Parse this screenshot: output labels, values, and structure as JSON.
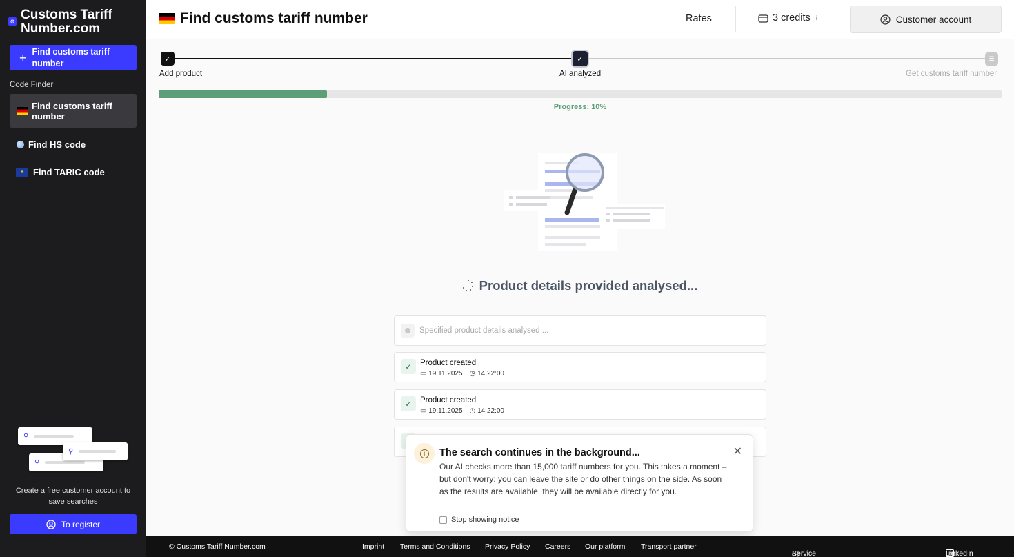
{
  "brand": {
    "name": "Customs Tariff Number.com"
  },
  "sidebar": {
    "new_button": "Find customs tariff number",
    "section_label": "Code Finder",
    "items": [
      {
        "label": "Find customs tariff number",
        "icon": "flag-de-icon",
        "active": true
      },
      {
        "label": "Find HS code",
        "icon": "globe-icon",
        "active": false
      },
      {
        "label": "Find TARIC code",
        "icon": "flag-eu-icon",
        "active": false
      }
    ],
    "register_text": "Create a free customer account to save searches",
    "register_button": "To register"
  },
  "header": {
    "title": "Find customs tariff number",
    "rates": "Rates",
    "credits": "3 credits",
    "credits_info": "i",
    "account": "Customer account"
  },
  "stepper": {
    "steps": [
      {
        "label": "Add product",
        "state": "done"
      },
      {
        "label": "AI analyzed",
        "state": "current"
      },
      {
        "label": "Get customs tariff number",
        "state": "pending"
      }
    ]
  },
  "progress": {
    "value": 0.2,
    "label": "Progress: 10%"
  },
  "analysis": {
    "title": "Product details provided analysed..."
  },
  "log": {
    "pending": "Specified product details analysed ...",
    "items": [
      {
        "title": "Product created",
        "date": "19.11.2025",
        "time": "14:22:00"
      },
      {
        "title": "Product created",
        "date": "19.11.2025",
        "time": "14:22:00"
      }
    ]
  },
  "toast": {
    "title": "The search continues in the background...",
    "body": "Our AI checks more than 15,000 tariff numbers for you. This takes a moment – but don't worry: you can leave the site or do other things on the side. As soon as the results are available, they will be available directly for you.",
    "checkbox": "Stop showing notice"
  },
  "footer": {
    "copyright": "© Customs Tariff Number.com",
    "links": [
      "Imprint",
      "Terms and Conditions",
      "Privacy Policy",
      "Careers",
      "Our platform",
      "Transport partner"
    ],
    "help": "Service & Help",
    "social": "LinkedIn"
  },
  "colors": {
    "accent": "#3b3bff",
    "sidebar": "#1c1c1e",
    "progress": "#5c9e78"
  }
}
